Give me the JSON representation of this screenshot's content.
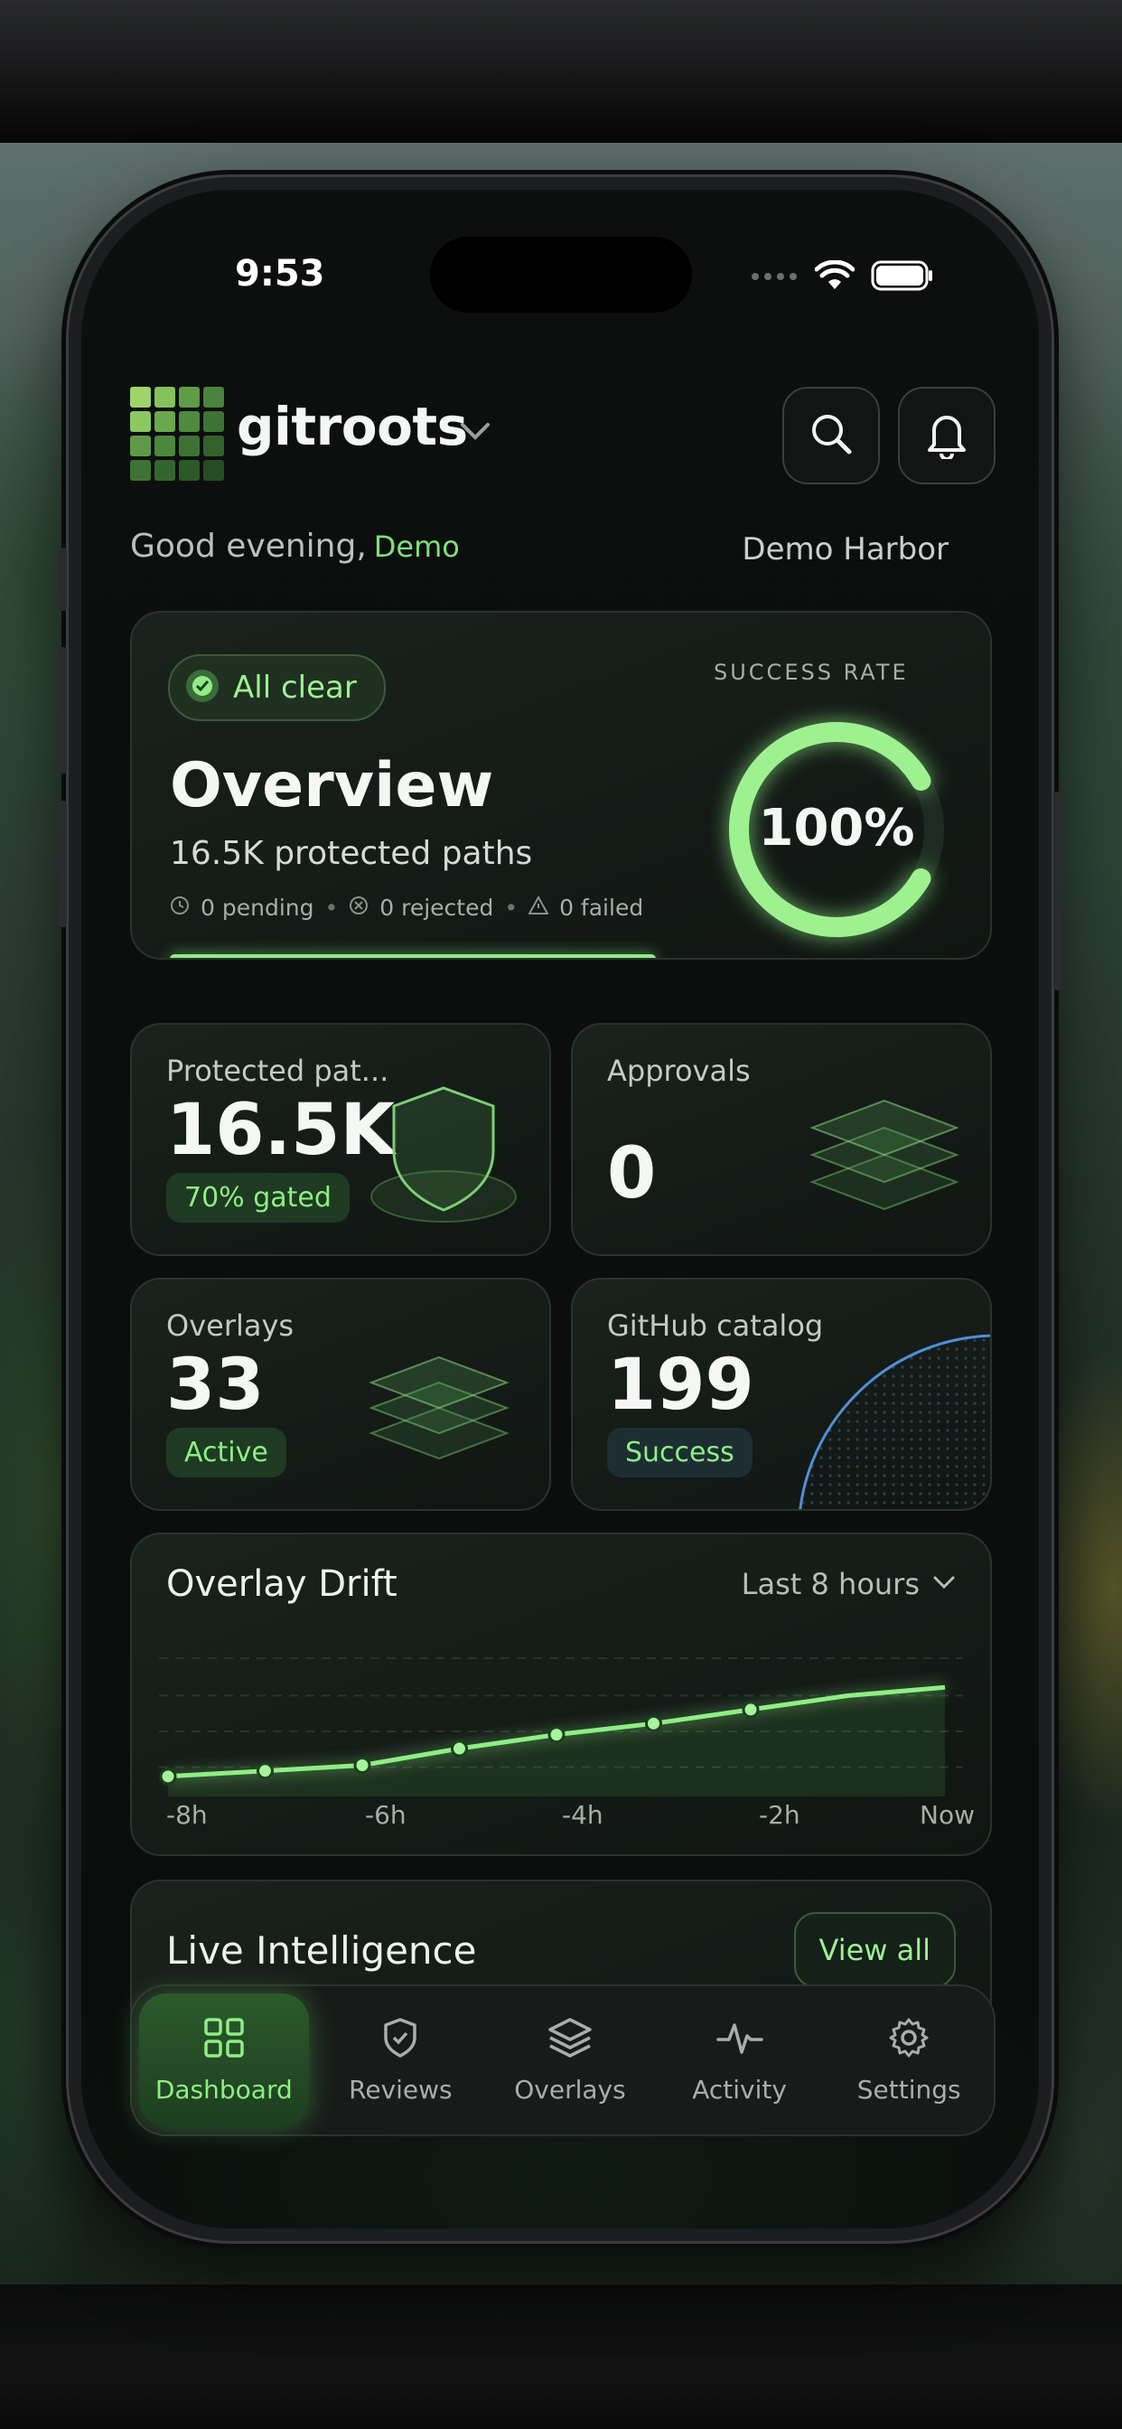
{
  "status_bar": {
    "time": "9:53"
  },
  "header": {
    "brand": "gitroots"
  },
  "greeting": {
    "text": "Good evening,",
    "name": "Demo",
    "workspace": "Demo Harbor"
  },
  "overview": {
    "badge": "All clear",
    "title": "Overview",
    "subtitle": "16.5K protected paths",
    "pending": "0 pending",
    "rejected": "0 rejected",
    "failed": "0 failed",
    "success_label": "SUCCESS RATE",
    "success_value": "100%",
    "success_fraction": 1.0,
    "progress_fraction": 1.0
  },
  "stats": {
    "protected": {
      "label": "Protected pat...",
      "value": "16.5K",
      "badge": "70% gated"
    },
    "approvals": {
      "label": "Approvals",
      "value": "0"
    },
    "overlays": {
      "label": "Overlays",
      "value": "33",
      "badge": "Active"
    },
    "github": {
      "label": "GitHub catalog",
      "value": "199",
      "badge": "Success"
    }
  },
  "drift": {
    "title": "Overlay Drift",
    "range": "Last 8 hours",
    "x_ticks": [
      "-8h",
      "-6h",
      "-4h",
      "-2h",
      "Now"
    ]
  },
  "chart_data": {
    "type": "line",
    "x": [
      "-8h",
      "-7h",
      "-6h",
      "-5h",
      "-4h",
      "-3h",
      "-2h",
      "-1h",
      "Now"
    ],
    "values": [
      4,
      8,
      12,
      24,
      34,
      42,
      52,
      62,
      68
    ],
    "markers": [
      true,
      true,
      true,
      true,
      true,
      true,
      true,
      false,
      false
    ],
    "ylim": [
      0,
      100
    ],
    "grid": true
  },
  "intel": {
    "title": "Live Intelligence",
    "view_all": "View all"
  },
  "nav": [
    {
      "label": "Dashboard",
      "icon": "dashboard-icon",
      "active": true
    },
    {
      "label": "Reviews",
      "icon": "shield-check-icon",
      "active": false
    },
    {
      "label": "Overlays",
      "icon": "layers-icon",
      "active": false
    },
    {
      "label": "Activity",
      "icon": "activity-icon",
      "active": false
    },
    {
      "label": "Settings",
      "icon": "gear-icon",
      "active": false
    }
  ],
  "colors": {
    "accent": "#8eee84",
    "background": "#0a0d0c",
    "card": "#141a16",
    "blue": "#4f8fd6"
  }
}
